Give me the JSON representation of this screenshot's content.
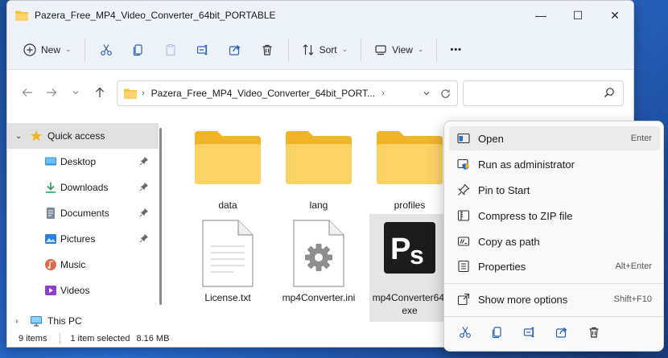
{
  "window": {
    "title": "Pazera_Free_MP4_Video_Converter_64bit_PORTABLE",
    "minimize": "—",
    "maximize": "☐",
    "close": "✕"
  },
  "toolbar": {
    "new_label": "New",
    "sort_label": "Sort",
    "view_label": "View",
    "more_label": "•••"
  },
  "address": {
    "path": "Pazera_Free_MP4_Video_Converter_64bit_PORT...",
    "separator": "›",
    "trailing": "›"
  },
  "sidebar": {
    "items": [
      {
        "label": "Quick access",
        "icon": "star-icon"
      },
      {
        "label": "Desktop",
        "icon": "desktop-icon"
      },
      {
        "label": "Downloads",
        "icon": "download-icon"
      },
      {
        "label": "Documents",
        "icon": "documents-icon"
      },
      {
        "label": "Pictures",
        "icon": "pictures-icon"
      },
      {
        "label": "Music",
        "icon": "music-icon"
      },
      {
        "label": "Videos",
        "icon": "videos-icon"
      },
      {
        "label": "This PC",
        "icon": "pc-icon"
      }
    ]
  },
  "files": [
    {
      "name": "data",
      "type": "folder"
    },
    {
      "name": "lang",
      "type": "folder"
    },
    {
      "name": "profiles",
      "type": "folder"
    },
    {
      "name": "License.txt",
      "type": "text"
    },
    {
      "name": "mp4Converter.ini",
      "type": "ini"
    },
    {
      "name": "mp4Converter64.exe",
      "line1": "mp4Converter64.",
      "line2": "exe",
      "type": "exe"
    }
  ],
  "status": {
    "items": "9 items",
    "selected": "1 item selected",
    "size": "8.16 MB"
  },
  "context_menu": {
    "items": [
      {
        "label": "Open",
        "shortcut": "Enter",
        "icon": "open-icon"
      },
      {
        "label": "Run as administrator",
        "shortcut": "",
        "icon": "shield-icon"
      },
      {
        "label": "Pin to Start",
        "shortcut": "",
        "icon": "pin-icon"
      },
      {
        "label": "Compress to ZIP file",
        "shortcut": "",
        "icon": "zip-icon"
      },
      {
        "label": "Copy as path",
        "shortcut": "",
        "icon": "copy-path-icon"
      },
      {
        "label": "Properties",
        "shortcut": "Alt+Enter",
        "icon": "properties-icon"
      },
      {
        "label": "Show more options",
        "shortcut": "Shift+F10",
        "icon": "more-options-icon"
      }
    ]
  },
  "colors": {
    "folder": "#f6c342",
    "folder_front": "#fbd56b",
    "accent": "#0067c0",
    "selection": "#e1e1e1"
  }
}
